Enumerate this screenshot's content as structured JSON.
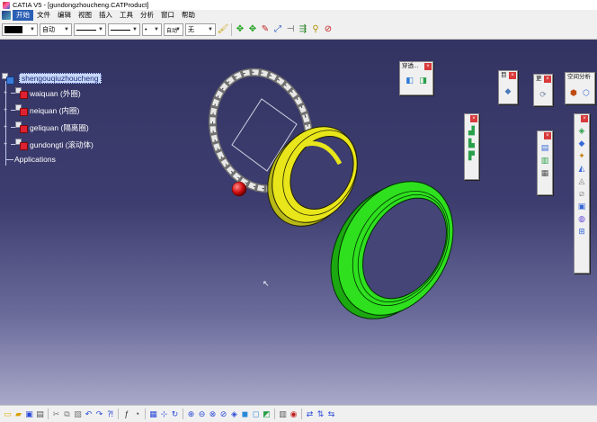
{
  "window": {
    "title": "CATIA V5 - [gundongzhoucheng.CATProduct]"
  },
  "menu": {
    "items": [
      "开始",
      "文件",
      "编辑",
      "视图",
      "插入",
      "工具",
      "分析",
      "窗口",
      "帮助"
    ]
  },
  "toolbar": {
    "color_value": "",
    "transparency_value": "自动",
    "linetype_value": "",
    "thickness_value": "",
    "point_value": "•",
    "layer_value": "自动",
    "filter_value": "无",
    "icons": [
      "paint-icon",
      "compass-move-icon",
      "compass-move-icon",
      "edit-icon",
      "manipulate-icon",
      "snap-icon",
      "explode-icon",
      "constraint-icon",
      "stop-manipulate-icon"
    ]
  },
  "tree": {
    "root": "shengouqiuzhoucheng",
    "children": [
      {
        "label": "waiquan (外圈)"
      },
      {
        "label": "neiquan (内圈)"
      },
      {
        "label": "geliquan (隔离圈)"
      },
      {
        "label": "gundongti (滚动体)"
      }
    ],
    "applications": "Applications"
  },
  "palettes": [
    {
      "id": "section",
      "title": "穿透...",
      "icons": [
        "section-icon",
        "section-view-icon"
      ]
    },
    {
      "id": "p1",
      "title": "目",
      "icons": [
        "eraser-icon"
      ]
    },
    {
      "id": "p2",
      "title": "更",
      "icons": [
        "update-icon"
      ]
    },
    {
      "id": "space",
      "title": "空间分析",
      "icons": [
        "clash-icon",
        "measure-icon"
      ]
    },
    {
      "id": "p3",
      "title": "",
      "icons": [
        "assembly-icon",
        "move-icon",
        "snap-icon"
      ]
    },
    {
      "id": "p4",
      "title": "",
      "icons": [
        "catalog-icon",
        "bom-icon",
        "scene-icon"
      ]
    },
    {
      "id": "p5",
      "title": "",
      "icons": [
        "tool-icon",
        "tool-icon",
        "tool-icon",
        "tool-icon",
        "tool-icon",
        "tool-icon",
        "tool-icon",
        "tool-icon",
        "tool-icon"
      ]
    }
  ],
  "colors": {
    "outer_ring": "#2ee01e",
    "inner_ring": "#e8e61a",
    "cage": "#d8d8d8",
    "ball": "#d41010",
    "background_top": "#343463",
    "background_bottom": "#a8a8c8"
  },
  "statusbar": {
    "icons": [
      "new-icon",
      "open-icon",
      "save-icon",
      "print-icon",
      "cut-icon",
      "copy-icon",
      "paste-icon",
      "undo-icon",
      "redo-icon",
      "help-icon",
      "fx-icon",
      "comment-icon",
      "view-icon",
      "pan-icon",
      "rotate-icon",
      "zoom-in-icon",
      "zoom-out-icon",
      "fit-all-icon",
      "normal-view-icon",
      "iso-view-icon",
      "shading-icon",
      "hide-icon",
      "swap-icon",
      "render-icon",
      "material-icon"
    ]
  }
}
